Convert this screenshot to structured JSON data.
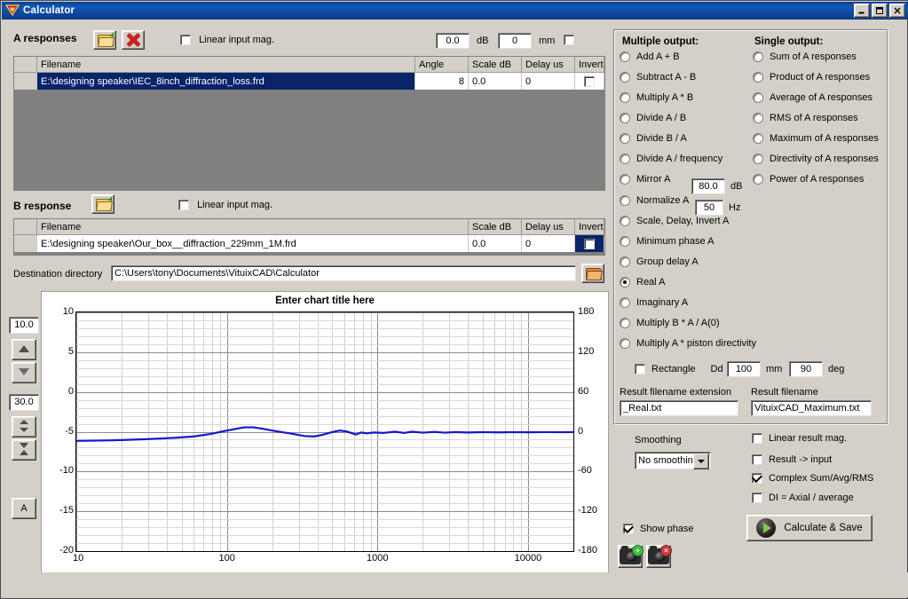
{
  "window": {
    "title": "Calculator",
    "minimize": "_",
    "maximize": "▫",
    "close": "✕"
  },
  "a_section": {
    "heading": "A responses",
    "open_icon": "open-folder-icon",
    "delete_icon": "red-x-icon",
    "linear_input_mag_label": "Linear input mag.",
    "linear_input_mag_checked": false,
    "offset_db_value": "0.0",
    "offset_db_unit": "dB",
    "offset_mm_value": "0",
    "offset_mm_unit": "mm",
    "mm_checkbox_checked": false,
    "columns": [
      "Filename",
      "Angle",
      "Scale dB",
      "Delay us",
      "Invert"
    ],
    "rows": [
      {
        "filename": "E:\\designing speaker\\IEC_8inch_diffraction_loss.frd",
        "angle": "8",
        "scale_db": "0.0",
        "delay_us": "0",
        "invert": false,
        "selected": true
      }
    ]
  },
  "b_section": {
    "heading": "B response",
    "open_icon": "open-folder-icon",
    "linear_input_mag_label": "Linear input mag.",
    "linear_input_mag_checked": false,
    "columns": [
      "Filename",
      "Scale dB",
      "Delay us",
      "Invert"
    ],
    "rows": [
      {
        "filename": "E:\\designing speaker\\Our_box__diffraction_229mm_1M.frd",
        "scale_db": "0.0",
        "delay_us": "0",
        "invert": false,
        "selected": false
      }
    ]
  },
  "destination": {
    "label": "Destination directory",
    "value": "C:\\Users\\tony\\Documents\\VituixCAD\\Calculator",
    "browse_icon": "folder-browse-icon"
  },
  "chart_tools": {
    "top_value": "10.0",
    "up_icon": "triangle-up-icon",
    "down_icon": "triangle-down-icon",
    "range_value": "30.0",
    "expand_icon": "expand-vertical-icon",
    "collapse_icon": "collapse-vertical-icon",
    "auto_label": "A"
  },
  "chart_data": {
    "type": "line",
    "title": "Enter chart title here",
    "xlabel": "",
    "ylabel": "",
    "xscale": "log",
    "xlim": [
      10,
      20000
    ],
    "ylim": [
      -20,
      10
    ],
    "y2lim": [
      -180,
      180
    ],
    "yticks": [
      10,
      5,
      0,
      -5,
      -10,
      -15,
      -20
    ],
    "y2ticks": [
      180,
      120,
      60,
      0,
      -60,
      -120,
      -180
    ],
    "xticks": [
      10,
      100,
      1000,
      10000
    ],
    "xticklabels": [
      "10",
      "100",
      "1000",
      "10000"
    ],
    "grid": true,
    "legend": "none",
    "series": [
      {
        "name": "Real A",
        "color": "#1616d0",
        "axis": "left",
        "x": [
          10,
          13,
          17,
          22,
          28,
          36,
          46,
          60,
          77,
          100,
          130,
          150,
          170,
          200,
          260,
          330,
          380,
          430,
          500,
          560,
          620,
          680,
          720,
          780,
          850,
          950,
          1100,
          1300,
          1500,
          1700,
          2000,
          2400,
          2800,
          3300,
          4000,
          5000,
          6500,
          8000,
          10000,
          13000,
          16000,
          20000
        ],
        "y": [
          -6.15,
          -6.12,
          -6.08,
          -6.02,
          -5.95,
          -5.86,
          -5.75,
          -5.6,
          -5.3,
          -4.85,
          -4.45,
          -4.45,
          -4.6,
          -4.85,
          -5.2,
          -5.55,
          -5.6,
          -5.4,
          -5.05,
          -4.85,
          -4.95,
          -5.2,
          -5.35,
          -5.1,
          -5.2,
          -5.1,
          -5.15,
          -5.0,
          -5.15,
          -5.0,
          -5.12,
          -5.02,
          -5.12,
          -5.04,
          -5.1,
          -5.05,
          -5.08,
          -5.05,
          -5.07,
          -5.05,
          -5.06,
          -5.05
        ]
      }
    ]
  },
  "options": {
    "multiple_output_heading": "Multiple output:",
    "single_output_heading": "Single output:",
    "multiple": [
      "Add A + B",
      "Subtract A - B",
      "Multiply A * B",
      "Divide A / B",
      "Divide B / A",
      "Divide A / frequency",
      "Mirror A",
      "Normalize A",
      "Scale, Delay, Invert A",
      "Minimum phase A",
      "Group delay A",
      "Real A",
      "Imaginary A",
      "Multiply B * A / A(0)",
      "Multiply A * piston directivity"
    ],
    "selected_multiple": "Real A",
    "single": [
      "Sum of A responses",
      "Product of A responses",
      "Average of A responses",
      "RMS of A responses",
      "Maximum of A responses",
      "Directivity of A responses",
      "Power of A responses"
    ],
    "selected_single": "",
    "mirror_value": "80.0",
    "mirror_unit": "dB",
    "normalize_value": "50",
    "normalize_unit": "Hz",
    "rectangle_label": "Rectangle",
    "rectangle_checked": false,
    "dd_label": "Dd",
    "dd_value": "100",
    "dd_unit": "mm",
    "deg_value": "90",
    "deg_unit": "deg",
    "result_ext_label": "Result filename extension",
    "result_ext_value": "_Real.txt",
    "result_filename_label": "Result filename",
    "result_filename_value": "VituixCAD_Maximum.txt"
  },
  "bottom": {
    "smoothing_label": "Smoothing",
    "smoothing_value": "No smoothing",
    "checks": [
      {
        "label": "Linear result mag.",
        "checked": false
      },
      {
        "label": "Result -> input",
        "checked": false
      },
      {
        "label": "Complex Sum/Avg/RMS",
        "checked": true
      },
      {
        "label": "DI = Axial / average",
        "checked": false
      }
    ],
    "show_phase_label": "Show phase",
    "show_phase_checked": true,
    "snapshot_add_icon": "camera-add-icon",
    "snapshot_remove_icon": "camera-remove-icon",
    "calculate_label": "Calculate & Save",
    "calculate_icon": "play-icon"
  },
  "colors": {
    "titlebar": "#0b3f91",
    "face": "#d4d0c8",
    "selection": "#0a246a",
    "trace": "#1616d0"
  }
}
